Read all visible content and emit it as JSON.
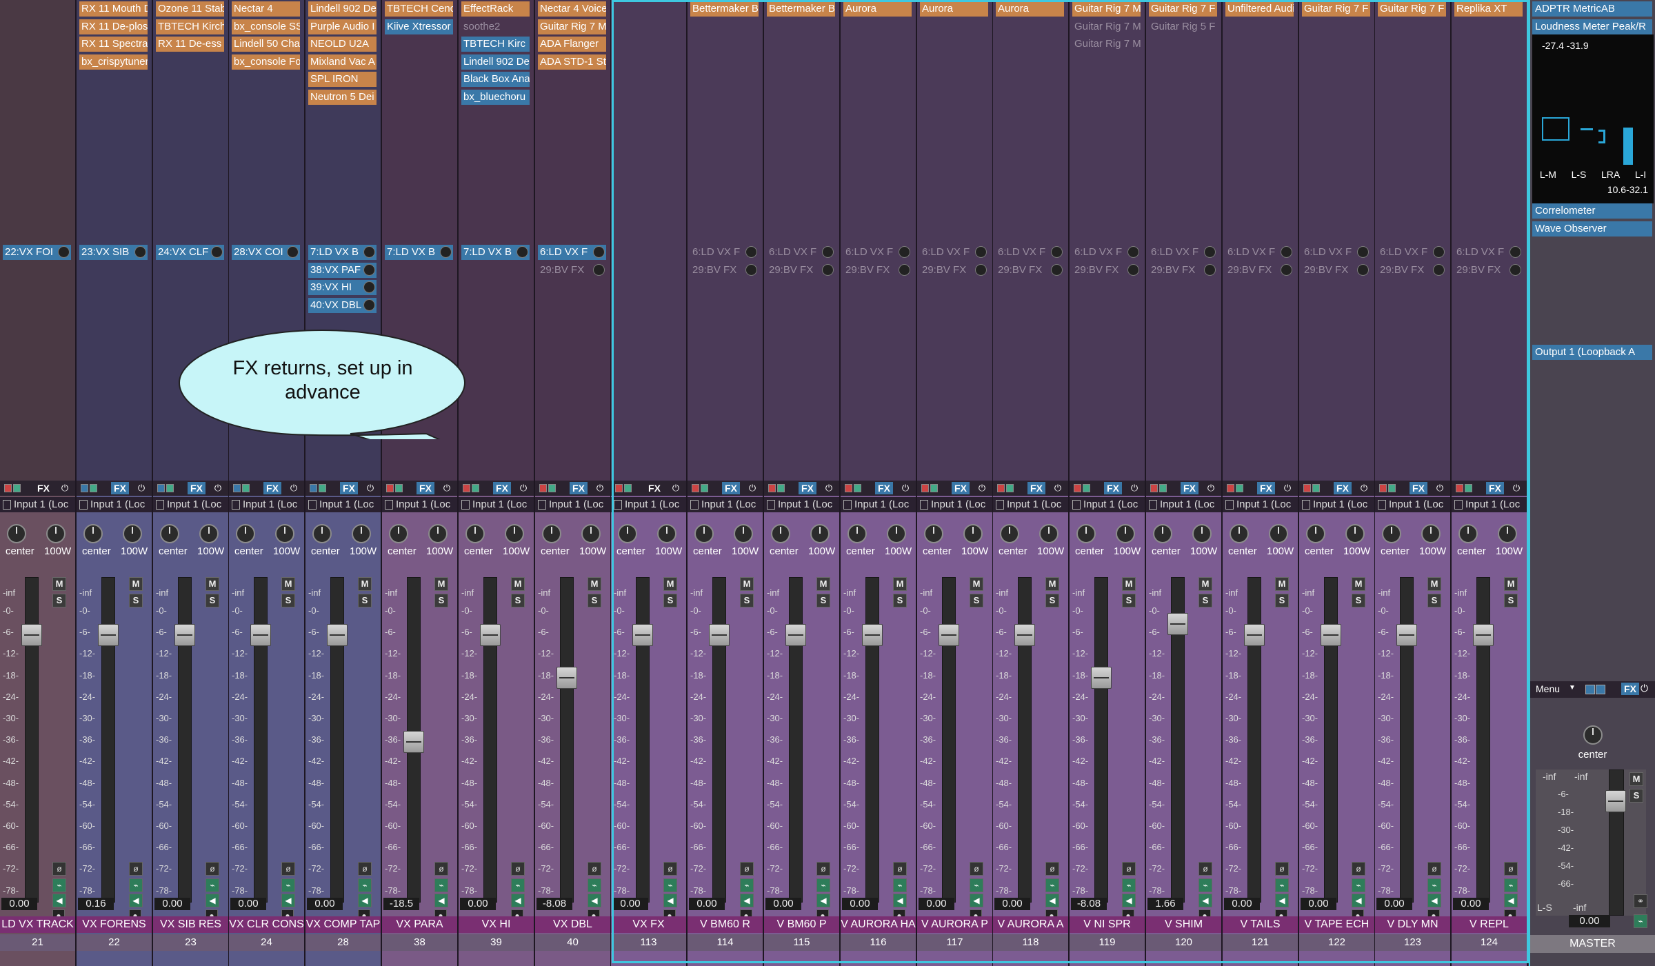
{
  "channels": [
    {
      "name": "LD VX TRACK",
      "num": "21",
      "vol": "0.00",
      "inserts": [
        "",
        "",
        "",
        ""
      ],
      "insert_styles": [],
      "sends": [
        {
          "label": "22:VX FOI",
          "dim": false
        }
      ],
      "pan": "center",
      "width": "100W",
      "input": "Input 1 (Loc",
      "fader_db": -5,
      "style": "dark"
    },
    {
      "name": "VX FORENS",
      "num": "22",
      "vol": "0.16",
      "inserts": [
        "RX 11 Mouth D",
        "RX 11 De-plos",
        "RX 11 Spectra",
        "bx_crispytuner"
      ],
      "sends": [
        {
          "label": "23:VX SIB",
          "dim": false
        }
      ],
      "pan": "center",
      "width": "100W",
      "input": "Input 1 (Loc",
      "fader_db": -5,
      "style": "blue"
    },
    {
      "name": "VX SIB RES",
      "num": "23",
      "vol": "0.00",
      "inserts": [
        "Ozone 11 Stab",
        "TBTECH Kirch",
        "RX 11 De-ess"
      ],
      "sends": [
        {
          "label": "24:VX CLF",
          "dim": false
        }
      ],
      "pan": "center",
      "width": "100W",
      "input": "Input 1 (Loc",
      "fader_db": -5,
      "style": "blue"
    },
    {
      "name": "VX CLR CONS",
      "num": "24",
      "vol": "0.00",
      "inserts": [
        "Nectar 4",
        "bx_console SS",
        "Lindell 50 Cha",
        "bx_console Fo"
      ],
      "sends": [
        {
          "label": "28:VX COI",
          "dim": false
        }
      ],
      "pan": "center",
      "width": "100W",
      "input": "Input 1 (Loc",
      "fader_db": -5,
      "style": "blue"
    },
    {
      "name": "VX COMP TAP",
      "num": "28",
      "vol": "0.00",
      "inserts": [
        "Lindell 902 De",
        "Purple Audio I",
        "NEOLD U2A",
        "Mixland Vac A",
        "SPL IRON",
        "Neutron 5 Dei"
      ],
      "sends": [
        {
          "label": "7:LD VX B",
          "dim": false
        },
        {
          "label": "38:VX PAF",
          "dim": false
        },
        {
          "label": "39:VX HI",
          "dim": false
        },
        {
          "label": "40:VX DBL",
          "dim": false
        }
      ],
      "pan": "center",
      "width": "100W",
      "input": "Input 1 (Loc",
      "fader_db": -5,
      "style": "blue"
    },
    {
      "name": "VX PARA",
      "num": "38",
      "vol": "-18.5",
      "inserts": [
        "TBTECH Cenc",
        "Kiive Xtressor"
      ],
      "sends": [
        {
          "label": "7:LD VX B",
          "dim": false
        }
      ],
      "pan": "center",
      "width": "100W",
      "input": "Input 1 (Loc",
      "fader_db": -35,
      "style": "pink"
    },
    {
      "name": "VX HI",
      "num": "39",
      "vol": "0.00",
      "inserts": [
        "EffectRack",
        "soothe2",
        "TBTECH Kirc",
        "Lindell 902 De",
        "Black Box Ana",
        "bx_bluechoru"
      ],
      "sends": [
        {
          "label": "7:LD VX B",
          "dim": false
        }
      ],
      "pan": "center",
      "width": "100W",
      "input": "Input 1 (Loc",
      "fader_db": -5,
      "style": "pink"
    },
    {
      "name": "VX DBL",
      "num": "40",
      "vol": "-8.08",
      "inserts": [
        "Nectar 4 Voice",
        "Guitar Rig 7 M",
        "ADA Flanger",
        "ADA STD-1 St"
      ],
      "sends": [
        {
          "label": "6:LD VX F",
          "dim": false
        },
        {
          "label": "29:BV FX",
          "dim": true
        }
      ],
      "pan": "center",
      "width": "100W",
      "input": "Input 1 (Loc",
      "fader_db": -17,
      "style": "pink"
    },
    {
      "name": "VX FX",
      "num": "113",
      "vol": "0.00",
      "inserts": [],
      "sends": [],
      "pan": "center",
      "width": "100W",
      "input": "Input 1 (Loc",
      "fader_db": -5,
      "style": "purple"
    },
    {
      "name": "V BM60 R",
      "num": "114",
      "vol": "0.00",
      "inserts": [
        "Bettermaker B"
      ],
      "sends": [
        {
          "label": "6:LD VX F",
          "dim": true
        },
        {
          "label": "29:BV FX",
          "dim": true
        }
      ],
      "pan": "center",
      "width": "100W",
      "input": "Input 1 (Loc",
      "fader_db": -5,
      "style": "purple"
    },
    {
      "name": "V BM60 P",
      "num": "115",
      "vol": "0.00",
      "inserts": [
        "Bettermaker B"
      ],
      "sends": [
        {
          "label": "6:LD VX F",
          "dim": true
        },
        {
          "label": "29:BV FX",
          "dim": true
        }
      ],
      "pan": "center",
      "width": "100W",
      "input": "Input 1 (Loc",
      "fader_db": -5,
      "style": "purple"
    },
    {
      "name": "V AURORA HA",
      "num": "116",
      "vol": "0.00",
      "inserts": [
        "Aurora"
      ],
      "sends": [
        {
          "label": "6:LD VX F",
          "dim": true
        },
        {
          "label": "29:BV FX",
          "dim": true
        }
      ],
      "pan": "center",
      "width": "100W",
      "input": "Input 1 (Loc",
      "fader_db": -5,
      "style": "purple"
    },
    {
      "name": "V AURORA P",
      "num": "117",
      "vol": "0.00",
      "inserts": [
        "Aurora"
      ],
      "sends": [
        {
          "label": "6:LD VX F",
          "dim": true
        },
        {
          "label": "29:BV FX",
          "dim": true
        }
      ],
      "pan": "center",
      "width": "100W",
      "input": "Input 1 (Loc",
      "fader_db": -5,
      "style": "purple"
    },
    {
      "name": "V AURORA A",
      "num": "118",
      "vol": "0.00",
      "inserts": [
        "Aurora"
      ],
      "sends": [
        {
          "label": "6:LD VX F",
          "dim": true
        },
        {
          "label": "29:BV FX",
          "dim": true
        }
      ],
      "pan": "center",
      "width": "100W",
      "input": "Input 1 (Loc",
      "fader_db": -5,
      "style": "purple"
    },
    {
      "name": "V NI SPR",
      "num": "119",
      "vol": "-8.08",
      "inserts": [
        "Guitar Rig 7 M",
        "Guitar Rig 7 M",
        "Guitar Rig 7 M"
      ],
      "sends": [
        {
          "label": "6:LD VX F",
          "dim": true
        },
        {
          "label": "29:BV FX",
          "dim": true
        }
      ],
      "pan": "center",
      "width": "100W",
      "input": "Input 1 (Loc",
      "fader_db": -17,
      "style": "purple"
    },
    {
      "name": "V SHIM",
      "num": "120",
      "vol": "1.66",
      "inserts": [
        "Guitar Rig 7 F",
        "Guitar Rig 5 F"
      ],
      "sends": [
        {
          "label": "6:LD VX F",
          "dim": true
        },
        {
          "label": "29:BV FX",
          "dim": true
        }
      ],
      "pan": "center",
      "width": "100W",
      "input": "Input 1 (Loc",
      "fader_db": -2,
      "style": "purple"
    },
    {
      "name": "V TAILS",
      "num": "121",
      "vol": "0.00",
      "inserts": [
        "Unfiltered Audi"
      ],
      "sends": [
        {
          "label": "6:LD VX F",
          "dim": true
        },
        {
          "label": "29:BV FX",
          "dim": true
        }
      ],
      "pan": "center",
      "width": "100W",
      "input": "Input 1 (Loc",
      "fader_db": -5,
      "style": "purple"
    },
    {
      "name": "V TAPE ECH",
      "num": "122",
      "vol": "0.00",
      "inserts": [
        "Guitar Rig 7 F"
      ],
      "sends": [
        {
          "label": "6:LD VX F",
          "dim": true
        },
        {
          "label": "29:BV FX",
          "dim": true
        }
      ],
      "pan": "center",
      "width": "100W",
      "input": "Input 1 (Loc",
      "fader_db": -5,
      "style": "purple"
    },
    {
      "name": "V DLY MN",
      "num": "123",
      "vol": "0.00",
      "inserts": [
        "Guitar Rig 7 F"
      ],
      "sends": [
        {
          "label": "6:LD VX F",
          "dim": true
        },
        {
          "label": "29:BV FX",
          "dim": true
        }
      ],
      "pan": "center",
      "width": "100W",
      "input": "Input 1 (Loc",
      "fader_db": -5,
      "style": "purple"
    },
    {
      "name": "V REPL",
      "num": "124",
      "vol": "0.00",
      "inserts": [
        "Replika XT"
      ],
      "sends": [
        {
          "label": "6:LD VX F",
          "dim": true
        },
        {
          "label": "29:BV FX",
          "dim": true
        }
      ],
      "pan": "center",
      "width": "100W",
      "input": "Input 1 (Loc",
      "fader_db": -5,
      "style": "purple"
    }
  ],
  "insert_variants": {
    "VX SIB RES": [
      false,
      false,
      false
    ],
    "VX PARA": [
      false,
      true
    ],
    "VX HI": [
      false,
      "dim",
      true,
      true,
      true,
      true
    ],
    "VX DBL": [
      false,
      false,
      false,
      false
    ],
    "V NI SPR": [
      false,
      "dim",
      "dim"
    ],
    "V SHIM": [
      false,
      "dim"
    ]
  },
  "scale_labels": [
    "-inf",
    "-0-",
    "-6-",
    "-12-",
    "-18-",
    "-24-",
    "-30-",
    "-36-",
    "-42-",
    "-48-",
    "-54-",
    "-60-",
    "-66-",
    "-72-",
    "-78-"
  ],
  "buttons": {
    "fx": "FX",
    "mute": "M",
    "solo": "S"
  },
  "master": {
    "inserts": [
      "ADPTR MetricAB",
      "Loudness Meter Peak/R"
    ],
    "meter_values": "-27.4  -31.9",
    "meter_labels": [
      "L-M",
      "L-S",
      "LRA",
      "L-I"
    ],
    "meter_range": "10.6-32.1",
    "post_inserts": [
      "Correlometer",
      "Wave Observer"
    ],
    "output": "Output 1 (Loopback A",
    "menu": "Menu",
    "pan": "center",
    "inf_left": "-inf",
    "inf_right": "-inf",
    "scale": [
      "-6-",
      "-18-",
      "-30-",
      "-42-",
      "-54-",
      "-66-"
    ],
    "ls_label": "L-S",
    "ls_value": "-inf",
    "vol": "0.00",
    "name": "MASTER"
  },
  "callout": {
    "text": "FX returns, set up in advance"
  },
  "colors": {
    "selection": "#3ec8e0",
    "insert": "#c8844a",
    "send": "#3a78a8",
    "name_bar": "#7a2f72"
  }
}
